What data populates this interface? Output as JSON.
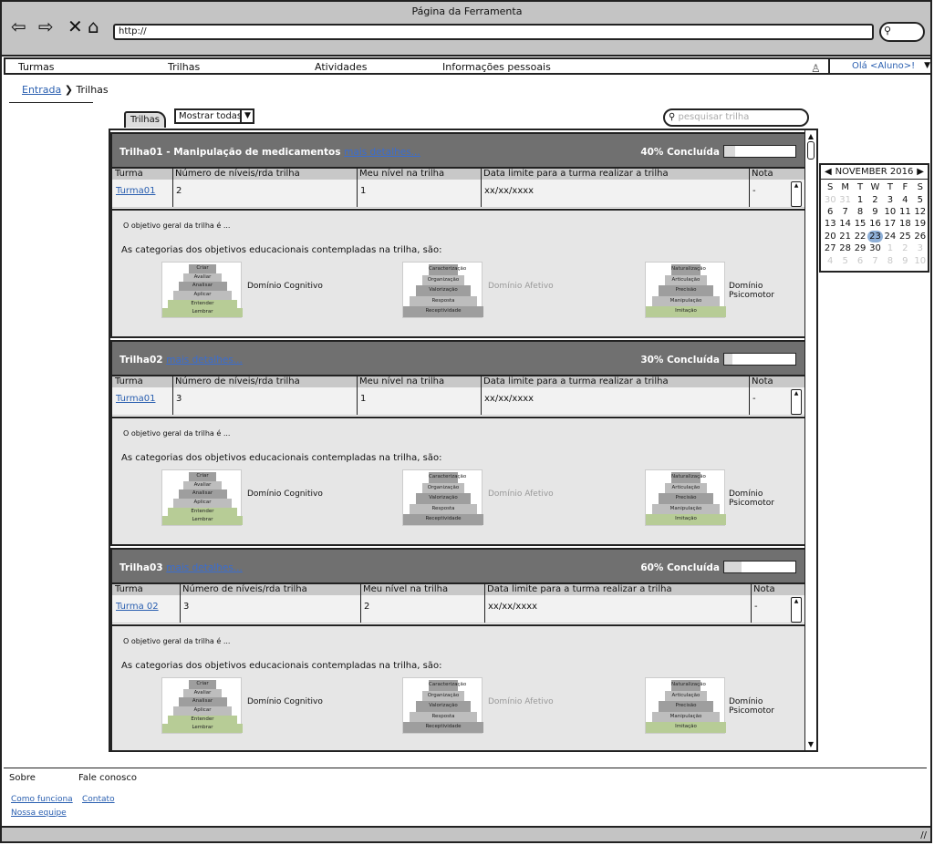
{
  "window": {
    "title": "Página da Ferramenta",
    "url": "http://"
  },
  "menu": {
    "items": [
      "Turmas",
      "Trilhas",
      "Atividades",
      "Informações pessoais"
    ],
    "user": "Olá <Aluno>!"
  },
  "breadcrumb": {
    "root": "Entrada",
    "current": "Trilhas"
  },
  "toolbar": {
    "tab": "Trilhas",
    "filter": "Mostrar todas",
    "search_placeholder": "pesquisar trilha"
  },
  "trilhas": [
    {
      "name": "Trilha01 - Manipulação de medicamentos",
      "link": "mais detalhes...",
      "progress_label": "40% Concluída",
      "progress": 0.4,
      "headers": [
        "Turma",
        "Número de níveis/rda trilha",
        "Meu nível na trilha",
        "Data limite para a turma realizar a trilha",
        "Nota"
      ],
      "row": [
        "Turma01",
        "2",
        "1",
        "xx/xx/xxxx",
        "-"
      ],
      "objective": "O objetivo geral da trilha é ...",
      "categories_text": "As categorias dos objetivos educacionais contempladas na trilha, são:"
    },
    {
      "name": "Trilha02",
      "link": "mais detalhes...",
      "progress_label": "30% Concluída",
      "progress": 0.3,
      "headers": [
        "Turma",
        "Número de níveis/rda trilha",
        "Meu nível na trilha",
        "Data limite para a turma realizar a trilha",
        "Nota"
      ],
      "row": [
        "Turma01",
        "3",
        "1",
        "xx/xx/xxxx",
        "-"
      ],
      "objective": "O objetivo geral da trilha é ...",
      "categories_text": "As categorias dos objetivos educacionais contempladas na trilha, são:"
    },
    {
      "name": "Trilha03",
      "link": "mais detalhes...",
      "progress_label": "60% Concluída",
      "progress": 0.6,
      "headers": [
        "Turma",
        "Número de níveis/rda trilha",
        "Meu nível na trilha",
        "Data limite para a turma realizar a trilha",
        "Nota"
      ],
      "row": [
        "Turma 02",
        "3",
        "2",
        "xx/xx/xxxx",
        "-"
      ],
      "objective": "O objetivo geral da trilha é ...",
      "categories_text": "As categorias dos objetivos educacionais contempladas na trilha, são:"
    }
  ],
  "domains": [
    {
      "label": "Domínio Cognitivo",
      "levels": [
        "Criar",
        "Avaliar",
        "Analisar",
        "Aplicar",
        "Entender",
        "Lembrar"
      ]
    },
    {
      "label": "Domínio Afetivo",
      "levels": [
        "Caracterização",
        "Organização",
        "Valorização",
        "Resposta",
        "Receptividade"
      ]
    },
    {
      "label": "Domínio Psicomotor",
      "levels": [
        "Naturalização",
        "Articulação",
        "Precisão",
        "Manipulação",
        "Imitação"
      ]
    }
  ],
  "calendar": {
    "month": "NOVEMBER 2016",
    "weekdays": [
      "S",
      "M",
      "T",
      "W",
      "T",
      "F",
      "S"
    ],
    "weeks": [
      [
        "30",
        "31",
        "1",
        "2",
        "3",
        "4",
        "5"
      ],
      [
        "6",
        "7",
        "8",
        "9",
        "10",
        "11",
        "12"
      ],
      [
        "13",
        "14",
        "15",
        "16",
        "17",
        "18",
        "19"
      ],
      [
        "20",
        "21",
        "22",
        "23",
        "24",
        "25",
        "26"
      ],
      [
        "27",
        "28",
        "29",
        "30",
        "1",
        "2",
        "3"
      ],
      [
        "4",
        "5",
        "6",
        "7",
        "8",
        "9",
        "10"
      ]
    ],
    "selected": "23"
  },
  "footer": {
    "about": "Sobre",
    "contact_title": "Fale conosco",
    "how": "Como funciona",
    "team": "Nossa equipe",
    "contact": "Contato"
  },
  "colors": {
    "accent_link": "#2a5fb0",
    "header_gray": "#707070",
    "level_green": "#b7cc96",
    "selected_day": "#8fb0d8"
  }
}
